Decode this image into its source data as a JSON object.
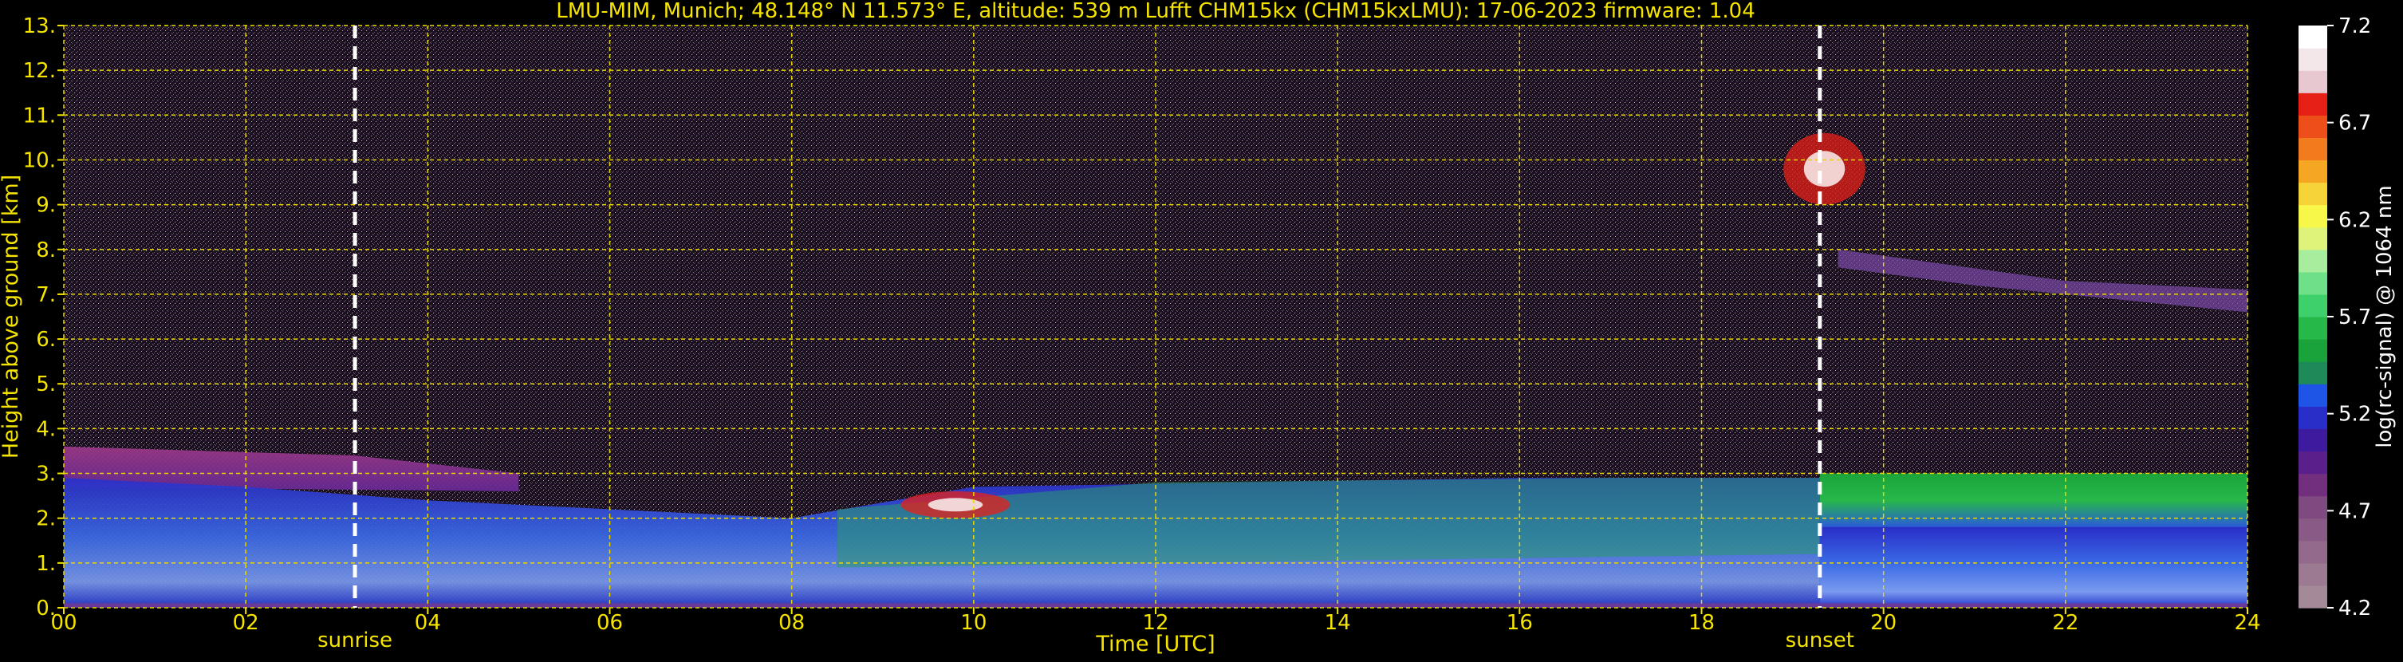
{
  "chart_data": {
    "type": "heatmap",
    "title": "LMU-MIM, Munich; 48.148° N 11.573° E, altitude: 539 m    Lufft CHM15kx (CHM15kxLMU): 17-06-2023    firmware: 1.04",
    "xlabel": "Time [UTC]",
    "ylabel": "Height above ground [km]",
    "xlim": [
      0,
      24
    ],
    "ylim": [
      0,
      13
    ],
    "x_tick_labels": [
      "00",
      "02",
      "04",
      "06",
      "08",
      "10",
      "12",
      "14",
      "16",
      "18",
      "20",
      "22",
      "24"
    ],
    "y_tick_labels": [
      "0.",
      "1.",
      "2.",
      "3.",
      "4.",
      "5.",
      "6.",
      "7.",
      "8.",
      "9.",
      "10.",
      "11.",
      "12.",
      "13."
    ],
    "grid": true,
    "events": [
      {
        "label": "sunrise",
        "time_utc": 3.2
      },
      {
        "label": "sunset",
        "time_utc": 19.3
      }
    ],
    "colorbar": {
      "label": "log(rc-signal) @ 1064 nm",
      "range": [
        4.2,
        7.2
      ],
      "tick_labels": [
        "4.2",
        "4.7",
        "5.2",
        "5.7",
        "6.2",
        "6.7",
        "7.2"
      ],
      "colors": [
        "#a48a98",
        "#9c7a92",
        "#946a8c",
        "#8a5a86",
        "#7e4a80",
        "#722f7d",
        "#5a1f8a",
        "#3d1a9e",
        "#2a2ec8",
        "#1f55e6",
        "#1e8a5a",
        "#1aa33a",
        "#27b84a",
        "#3ed06a",
        "#6fe08a",
        "#a8ec9e",
        "#dff27a",
        "#f7f74a",
        "#f7d33a",
        "#f5a623",
        "#f27c1d",
        "#ee4f1a",
        "#e62017",
        "#e8c8d0",
        "#f4e7ea",
        "#ffffff"
      ]
    },
    "cloud_layers": [
      {
        "description_time": [
          9.2,
          10.4
        ],
        "height_km": [
          2.0,
          2.6
        ]
      },
      {
        "description_time": [
          18.9,
          19.8
        ],
        "height_km": [
          9.0,
          10.6
        ]
      }
    ]
  }
}
